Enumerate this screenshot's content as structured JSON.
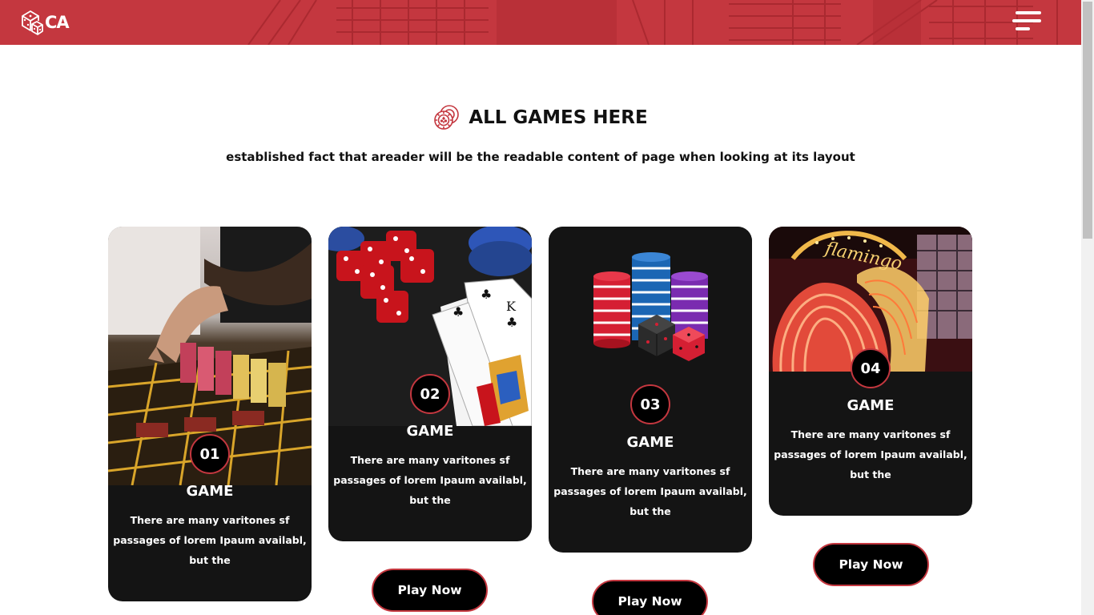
{
  "header": {
    "logo_text": "CA",
    "brand_color": "#c4373f",
    "menu_icon": "hamburger-menu-icon"
  },
  "section": {
    "title": "ALL GAMES HERE",
    "title_icon": "casino-chips-icon",
    "subtitle": "established fact that areader will be the readable content of page when looking at its layout"
  },
  "cards": [
    {
      "number": "01",
      "title": "GAME",
      "text": "There are many varitones sf passages of lorem Ipaum availabl, but the",
      "image": "roulette-table-image"
    },
    {
      "number": "02",
      "title": "GAME",
      "text": "There are many varitones sf passages of lorem Ipaum availabl, but the",
      "image": "dice-and-cards-image",
      "button": "Play Now"
    },
    {
      "number": "03",
      "title": "GAME",
      "text": "There are many varitones sf passages of lorem Ipaum availabl, but the",
      "image": "chip-stacks-and-dice-image",
      "button": "Play Now"
    },
    {
      "number": "04",
      "title": "GAME",
      "text": "There are many varitones sf passages of lorem Ipaum availabl, but the",
      "image": "neon-casino-sign-image",
      "button": "Play Now"
    }
  ]
}
